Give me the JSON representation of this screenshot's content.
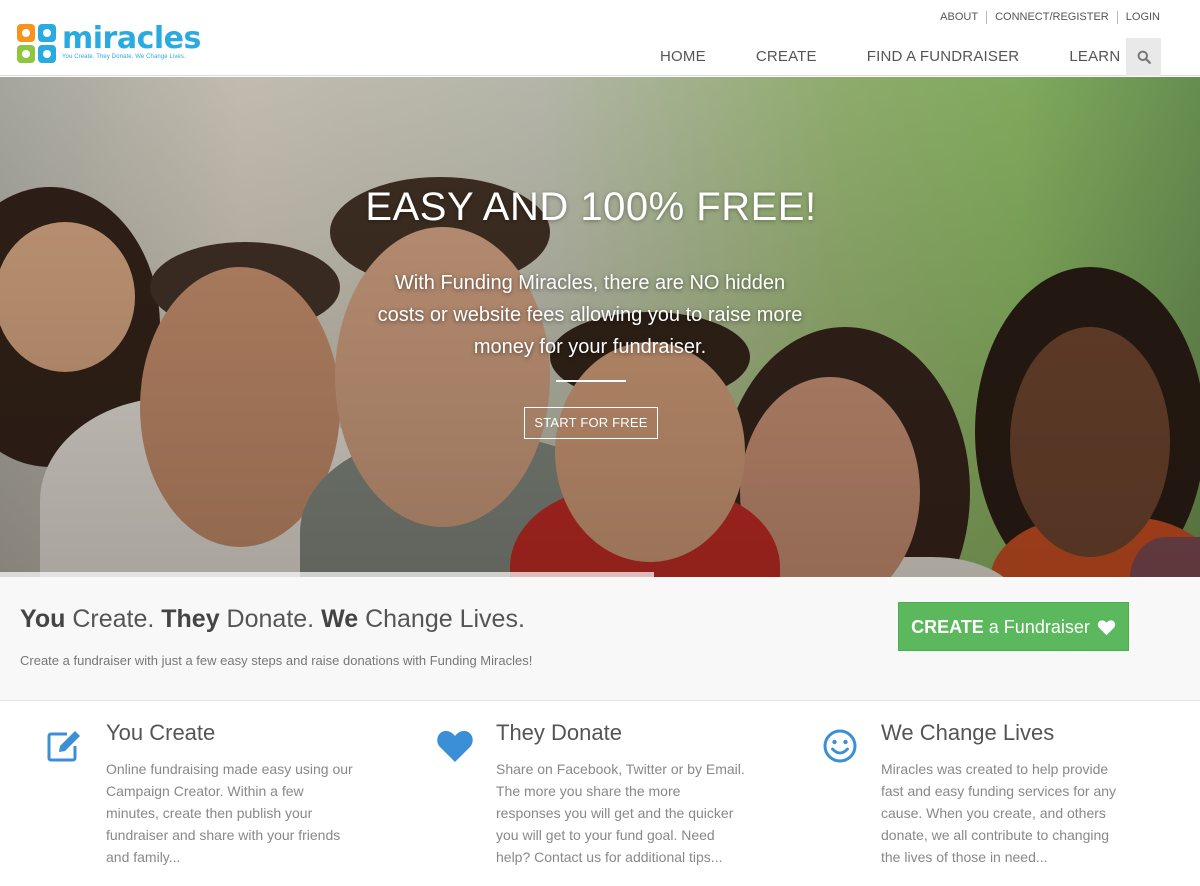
{
  "header": {
    "logo": {
      "word": "miracles",
      "tagline": "You Create. They Donate. We Change Lives."
    },
    "top_links": [
      "ABOUT",
      "CONNECT/REGISTER",
      "LOGIN"
    ],
    "nav": [
      "HOME",
      "CREATE",
      "FIND A FUNDRAISER",
      "LEARN"
    ],
    "search_icon": "search-icon"
  },
  "hero": {
    "title": "EASY AND 100% FREE!",
    "subtitle": "With Funding Miracles, there are NO hidden costs or website fees allowing you to raise more money for your fundraiser.",
    "button": "START FOR FREE"
  },
  "band": {
    "title": {
      "w1": "You",
      "t1": " Create. ",
      "w2": "They",
      "t2": " Donate. ",
      "w3": "We",
      "t3": " Change Lives."
    },
    "desc": "Create a fundraiser with just a few easy steps and raise donations with Funding Miracles!",
    "cta": {
      "bold": "CREATE",
      "rest": " a Fundraiser"
    }
  },
  "features": [
    {
      "icon": "edit-icon",
      "title": "You Create",
      "text": "Online fundraising made easy using our Campaign Creator. Within a few minutes, create then publish your fundraiser and share with your friends and family..."
    },
    {
      "icon": "heart-icon",
      "title": "They Donate",
      "text": "Share on Facebook, Twitter or by Email. The more you share the more responses you will get and the quicker you will get to your fund goal. Need help? Contact us for additional tips..."
    },
    {
      "icon": "smile-icon",
      "title": "We Change Lives",
      "text": "Miracles was created to help provide fast and easy funding services for any cause. When you create, and others donate, we all contribute to changing the lives of those in need..."
    }
  ],
  "colors": {
    "brand_blue": "#29abe2",
    "cta_green": "#5cb85c",
    "icon_blue": "#3a8fd6"
  }
}
